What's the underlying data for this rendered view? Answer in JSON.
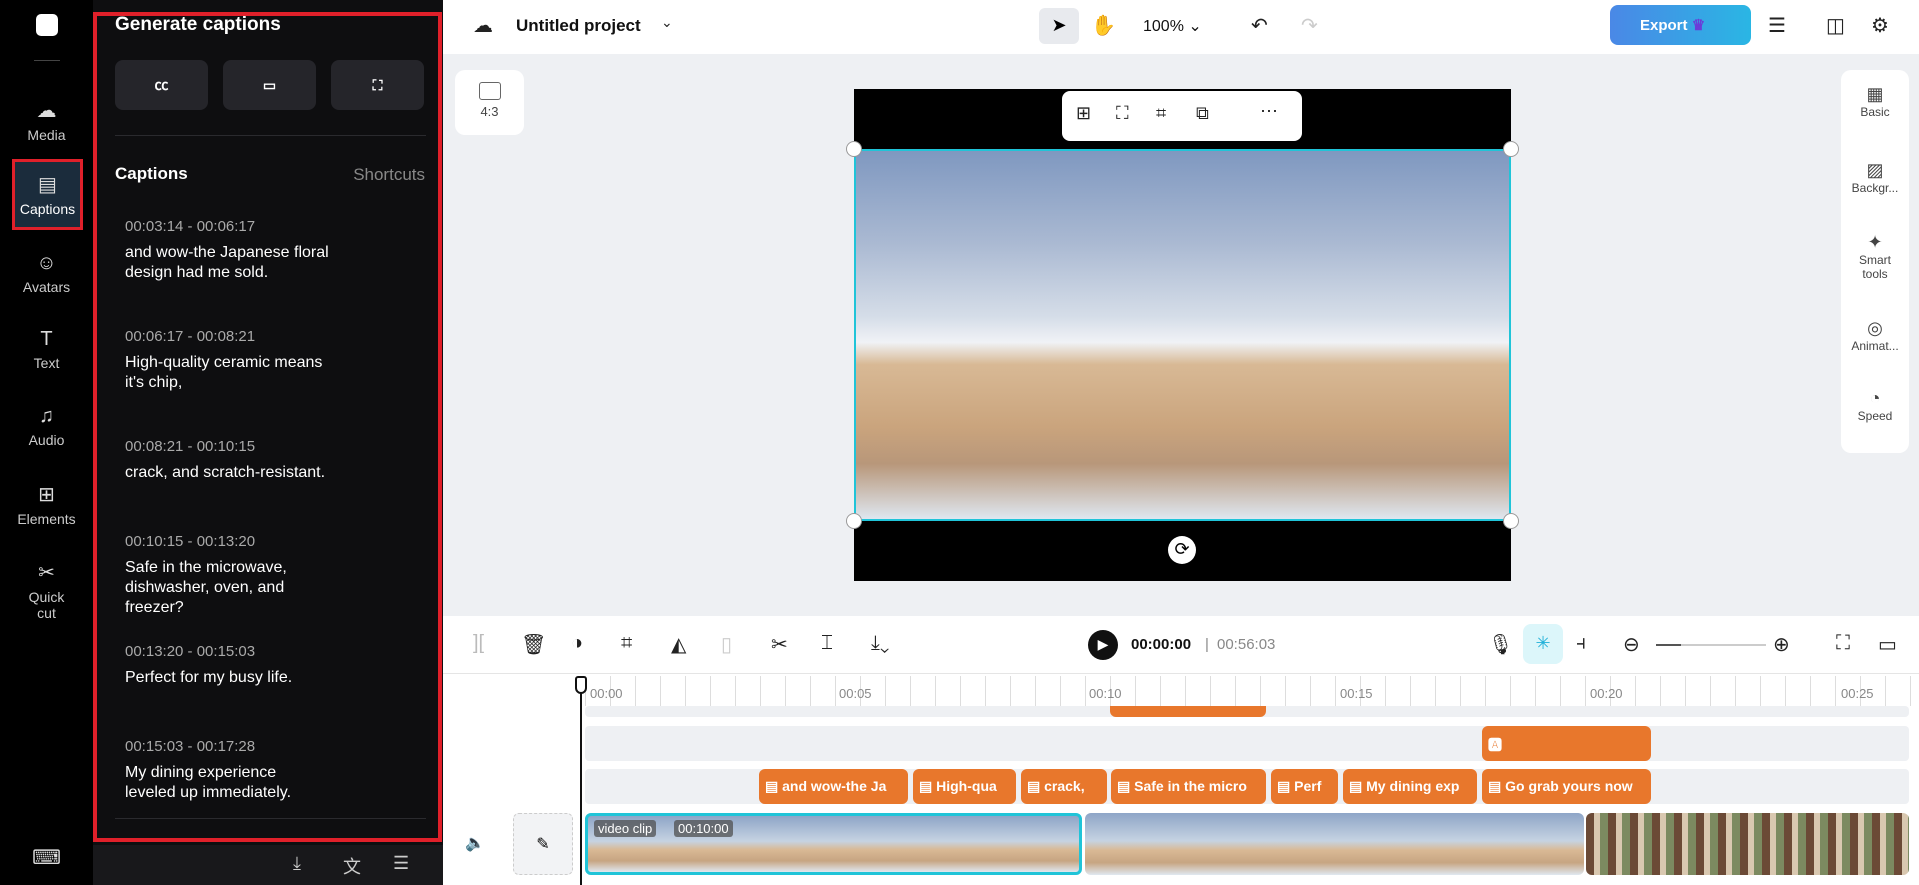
{
  "sidebar": {
    "items": [
      {
        "label": "Media",
        "icon": "cloud-upload-icon"
      },
      {
        "label": "Captions",
        "icon": "captions-icon"
      },
      {
        "label": "Avatars",
        "icon": "avatar-icon"
      },
      {
        "label": "Text",
        "icon": "text-icon"
      },
      {
        "label": "Audio",
        "icon": "music-icon"
      },
      {
        "label": "Elements",
        "icon": "elements-icon"
      },
      {
        "label": "Quick cut",
        "icon": "quick-cut-icon"
      }
    ]
  },
  "panel": {
    "title": "Generate captions",
    "section": "Captions",
    "shortcuts": "Shortcuts",
    "captions": [
      {
        "time": "00:03:14 - 00:06:17",
        "text": "and wow-the Japanese floral design had me sold."
      },
      {
        "time": "00:06:17 - 00:08:21",
        "text": "High-quality ceramic means it's chip,"
      },
      {
        "time": "00:08:21 - 00:10:15",
        "text": "crack, and scratch-resistant."
      },
      {
        "time": "00:10:15 - 00:13:20",
        "text": "Safe in the microwave, dishwasher, oven, and freezer?"
      },
      {
        "time": "00:13:20 - 00:15:03",
        "text": "Perfect for my busy life."
      },
      {
        "time": "00:15:03 - 00:17:28",
        "text": "My dining experience leveled up immediately."
      }
    ]
  },
  "header": {
    "project": "Untitled project",
    "zoom": "100%",
    "export": "Export"
  },
  "canvas": {
    "ratio": "4:3"
  },
  "right_panel": [
    "Basic",
    "Backgr...",
    "Smart tools",
    "Animat...",
    "Speed"
  ],
  "playback": {
    "current": "00:00:00",
    "total": "00:56:03"
  },
  "ruler": [
    "00:00",
    "00:05",
    "00:10",
    "00:15",
    "00:20",
    "00:25"
  ],
  "caption_clips": [
    "and wow-the Ja",
    "High-qua",
    "crack,",
    "Safe in the micro",
    "Perf",
    "My dining exp",
    "Go grab yours now"
  ],
  "video_clip": {
    "label": "video clip",
    "duration": "00:10:00"
  },
  "colors": {
    "accent": "#e8772c",
    "selection": "#20c4d8",
    "export": "#3b8be8"
  }
}
